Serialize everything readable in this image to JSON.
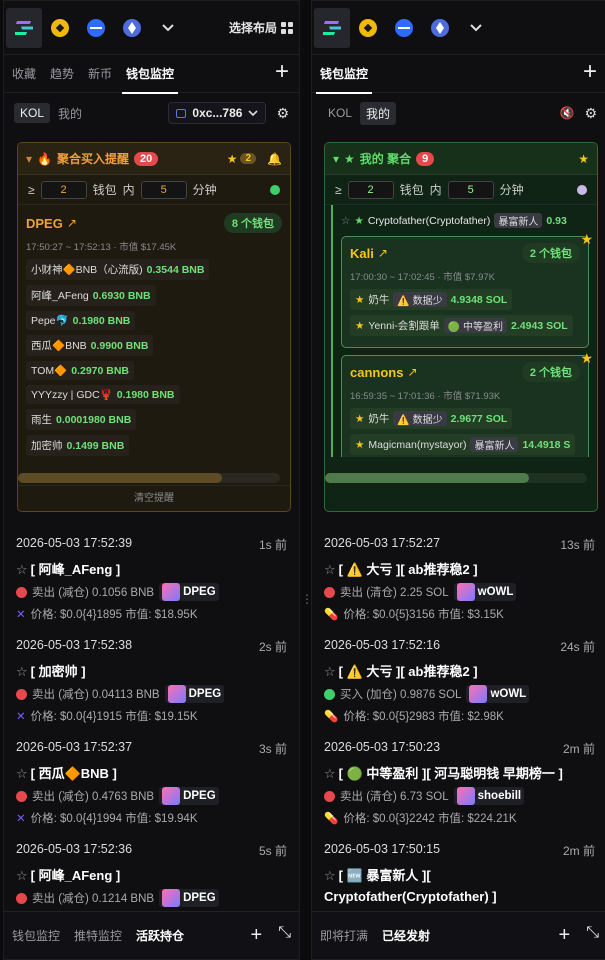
{
  "left": {
    "topbar": {
      "layout_label": "选择布局"
    },
    "tabs": [
      "收藏",
      "趋势",
      "新币",
      "钱包监控"
    ],
    "active_tab": "钱包监控",
    "segments": [
      "KOL",
      "我的"
    ],
    "address": "0xc...786",
    "alert": {
      "title": "聚合买入提醒",
      "count": "20",
      "star_count": "2",
      "ge": "≥",
      "min_wallets": "2",
      "wallet_label": "钱包",
      "within": "内",
      "minutes": "5",
      "minute_label": "分钟",
      "token": {
        "name": "DPEG",
        "wallets": "8 个钱包",
        "meta": "17:50:27 ~ 17:52:13 · 市值 $17.45K",
        "rows": [
          {
            "name": "小财神🔶BNB（心流版)",
            "amt": "0.3544 BNB"
          },
          {
            "name": "阿峰_AFeng",
            "amt": "0.6930 BNB"
          },
          {
            "name": "Pepe🐬",
            "amt": "0.1980 BNB"
          },
          {
            "name": "西瓜🔶BNB",
            "amt": "0.9900 BNB"
          },
          {
            "name": "TOM🔶",
            "amt": "0.2970 BNB"
          },
          {
            "name": "YYYzzy | GDC🦞",
            "amt": "0.1980 BNB"
          },
          {
            "name": "雨生",
            "amt": "0.0001980 BNB"
          },
          {
            "name": "加密帅",
            "amt": "0.1499 BNB"
          }
        ]
      },
      "clear_label": "清空提醒"
    },
    "feed": [
      {
        "time": "2026-05-03 17:52:39",
        "ago": "1s 前",
        "title": "[ 阿峰_AFeng ]",
        "action": "卖出 (减仓) 0.1056 BNB",
        "token": "DPEG",
        "price": "价格: $0.0{4}1895 市值: $18.95K",
        "dot": "#e5484d"
      },
      {
        "time": "2026-05-03 17:52:38",
        "ago": "2s 前",
        "title": "[ 加密帅 ]",
        "action": "卖出 (减仓) 0.04113 BNB",
        "token": "DPEG",
        "price": "价格: $0.0{4}1915 市值: $19.15K",
        "dot": "#e5484d"
      },
      {
        "time": "2026-05-03 17:52:37",
        "ago": "3s 前",
        "title": "[ 西瓜🔶BNB ]",
        "action": "卖出 (减仓) 0.4763 BNB",
        "token": "DPEG",
        "price": "价格: $0.0{4}1994 市值: $19.94K",
        "dot": "#e5484d"
      },
      {
        "time": "2026-05-03 17:52:36",
        "ago": "5s 前",
        "title": "[ 阿峰_AFeng ]",
        "action": "卖出 (减仓) 0.1214 BNB",
        "token": "DPEG",
        "price": "",
        "dot": "#e5484d"
      }
    ],
    "bottom_tabs": [
      "钱包监控",
      "推特监控",
      "活跃持仓"
    ],
    "bottom_active": "活跃持仓"
  },
  "right": {
    "tabs": [
      "钱包监控"
    ],
    "segments": [
      "KOL",
      "我的"
    ],
    "alert": {
      "title": "我的 聚合",
      "count": "9",
      "ge": "≥",
      "min_wallets": "2",
      "wallet_label": "钱包",
      "within": "内",
      "minutes": "5",
      "minute_label": "分钟",
      "partial_row": {
        "name": "Cryptofather(Cryptofather)",
        "tag": "暴富新人",
        "amt": "0.93"
      },
      "cards": [
        {
          "name": "Kali",
          "wallets": "2 个钱包",
          "meta": "17:00:30 ~ 17:02:45 · 市值 $7.97K",
          "rows": [
            {
              "name": "奶牛",
              "tag": "⚠️ 数据少",
              "amt": "4.9348 SOL"
            },
            {
              "name": "Yenni-会割跟单",
              "tag": "🟢 中等盈利",
              "amt": "2.4943 SOL"
            }
          ]
        },
        {
          "name": "cannons",
          "wallets": "2 个钱包",
          "meta": "16:59:35 ~ 17:01:36 · 市值 $71.93K",
          "rows": [
            {
              "name": "奶牛",
              "tag": "⚠️ 数据少",
              "amt": "2.9677 SOL"
            },
            {
              "name": "Magicman(mystayor)",
              "tag": "暴富新人",
              "amt": "14.4918 S"
            }
          ]
        }
      ]
    },
    "feed": [
      {
        "time": "2026-05-03 17:52:27",
        "ago": "13s 前",
        "title": "[ ⚠️ 大亏 ][ ab推荐稳2 ]",
        "action": "卖出 (清仓) 2.25 SOL",
        "token": "wOWL",
        "price": "价格: $0.0{5}3156 市值: $3.15K",
        "dot": "#e5484d"
      },
      {
        "time": "2026-05-03 17:52:16",
        "ago": "24s 前",
        "title": "[ ⚠️ 大亏 ][ ab推荐稳2 ]",
        "action": "买入 (加仓) 0.9876 SOL",
        "token": "wOWL",
        "price": "价格: $0.0{5}2983 市值: $2.98K",
        "dot": "#3fcf6a"
      },
      {
        "time": "2026-05-03 17:50:23",
        "ago": "2m 前",
        "title": "[ 🟢 中等盈利 ][ 河马聪明钱 早期榜一 ]",
        "action": "卖出 (清仓) 6.73 SOL",
        "token": "shoebill",
        "price": "价格: $0.0{3}2242 市值: $224.21K",
        "dot": "#e5484d"
      },
      {
        "time": "2026-05-03 17:50:15",
        "ago": "2m 前",
        "title": "[ 🆕 暴富新人 ][",
        "action": "Cryptofather(Cryptofather) ]",
        "token": "",
        "price": "",
        "dot": ""
      }
    ],
    "bottom_tabs": [
      "即将打满",
      "已经发射"
    ],
    "bottom_active": "已经发射"
  }
}
